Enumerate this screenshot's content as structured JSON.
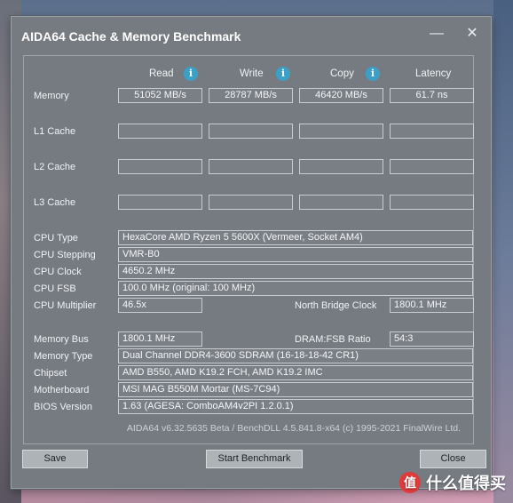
{
  "window": {
    "title": "AIDA64 Cache & Memory Benchmark",
    "minimize_glyph": "—",
    "close_glyph": "✕"
  },
  "columns": {
    "read": "Read",
    "write": "Write",
    "copy": "Copy",
    "latency": "Latency",
    "info_glyph": "i"
  },
  "rows": {
    "memory": {
      "label": "Memory",
      "read": "51052 MB/s",
      "write": "28787 MB/s",
      "copy": "46420 MB/s",
      "latency": "61.7 ns"
    },
    "l1": {
      "label": "L1 Cache",
      "read": "",
      "write": "",
      "copy": "",
      "latency": ""
    },
    "l2": {
      "label": "L2 Cache",
      "read": "",
      "write": "",
      "copy": "",
      "latency": ""
    },
    "l3": {
      "label": "L3 Cache",
      "read": "",
      "write": "",
      "copy": "",
      "latency": ""
    }
  },
  "cpu": {
    "type_label": "CPU Type",
    "type_value": "HexaCore AMD Ryzen 5 5600X  (Vermeer, Socket AM4)",
    "stepping_label": "CPU Stepping",
    "stepping_value": "VMR-B0",
    "clock_label": "CPU Clock",
    "clock_value": "4650.2 MHz",
    "fsb_label": "CPU FSB",
    "fsb_value": "100.0 MHz  (original: 100 MHz)",
    "multiplier_label": "CPU Multiplier",
    "multiplier_value": "46.5x",
    "nb_clock_label": "North Bridge Clock",
    "nb_clock_value": "1800.1 MHz"
  },
  "memory_info": {
    "bus_label": "Memory Bus",
    "bus_value": "1800.1 MHz",
    "dram_fsb_label": "DRAM:FSB Ratio",
    "dram_fsb_value": "54:3",
    "type_label": "Memory Type",
    "type_value": "Dual Channel DDR4-3600 SDRAM  (16-18-18-42 CR1)",
    "chipset_label": "Chipset",
    "chipset_value": "AMD B550, AMD K19.2 FCH, AMD K19.2 IMC",
    "motherboard_label": "Motherboard",
    "motherboard_value": "MSI MAG B550M Mortar (MS-7C94)",
    "bios_label": "BIOS Version",
    "bios_value": "1.63  (AGESA: ComboAM4v2PI 1.2.0.1)"
  },
  "footer": "AIDA64 v6.32.5635 Beta / BenchDLL 4.5.841.8-x64  (c) 1995-2021 FinalWire Ltd.",
  "buttons": {
    "save": "Save",
    "start": "Start Benchmark",
    "close": "Close"
  },
  "watermark": {
    "text": "什么值得买",
    "icon": "值"
  }
}
